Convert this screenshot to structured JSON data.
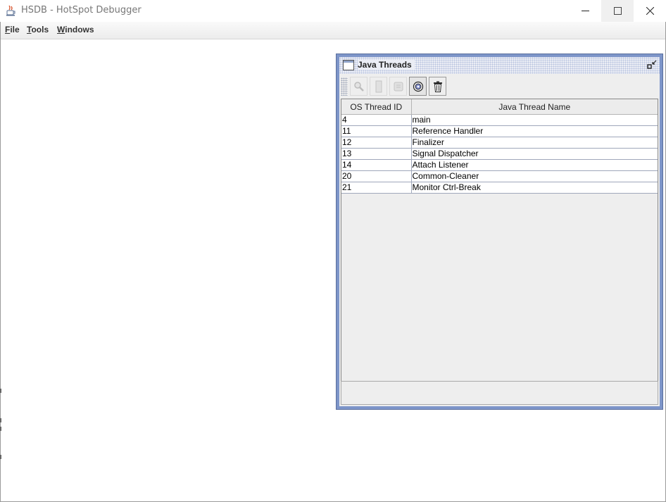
{
  "window": {
    "title": "HSDB - HotSpot Debugger",
    "icon": "java-cup-icon"
  },
  "window_controls": {
    "minimize_icon": "minimize-icon",
    "maximize_icon": "maximize-icon",
    "close_icon": "close-icon"
  },
  "menubar": {
    "items": [
      {
        "mnemonic": "F",
        "rest": "ile"
      },
      {
        "mnemonic": "T",
        "rest": "ools"
      },
      {
        "mnemonic": "W",
        "rest": "indows"
      }
    ]
  },
  "java_threads": {
    "title": "Java Threads",
    "toolbar": [
      {
        "icon": "inspect-icon",
        "enabled": false
      },
      {
        "icon": "stack-memory-icon",
        "enabled": false
      },
      {
        "icon": "thread-info-icon",
        "enabled": false
      },
      {
        "icon": "find-crashes-icon",
        "enabled": true
      },
      {
        "icon": "trash-icon",
        "enabled": true
      }
    ],
    "columns": [
      "OS Thread ID",
      "Java Thread Name"
    ],
    "rows": [
      [
        "4",
        "main"
      ],
      [
        "11",
        "Reference Handler"
      ],
      [
        "12",
        "Finalizer"
      ],
      [
        "13",
        "Signal Dispatcher"
      ],
      [
        "14",
        "Attach Listener"
      ],
      [
        "20",
        "Common-Cleaner"
      ],
      [
        "21",
        "Monitor Ctrl-Break"
      ]
    ]
  },
  "colors": {
    "frame_border": "#7d95c9",
    "title_dots": "#b7c2de"
  }
}
